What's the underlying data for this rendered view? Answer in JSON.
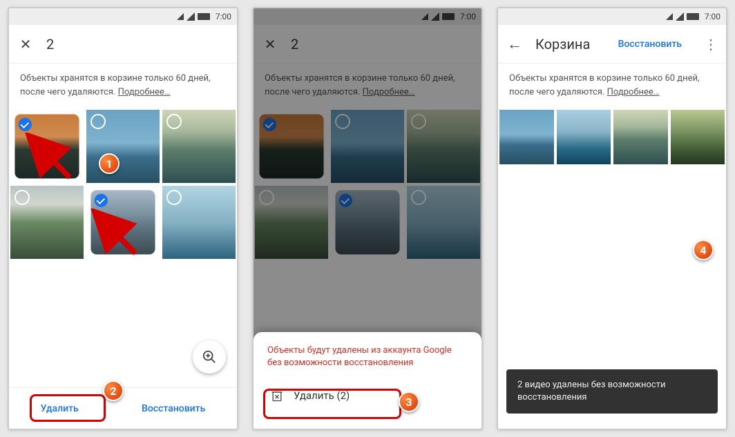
{
  "status": {
    "time": "7:00"
  },
  "screen1": {
    "header_count": "2",
    "info": "Объекты хранятся в корзине только 60 дней, после чего удаляются.",
    "more": "Подробнее…",
    "footer_delete": "Удалить",
    "footer_restore": "Восстановить",
    "thumbs": [
      {
        "cls": "sunset",
        "selected": true
      },
      {
        "cls": "lake1",
        "selected": false
      },
      {
        "cls": "mountain1",
        "selected": false
      },
      {
        "cls": "valley",
        "selected": false
      },
      {
        "cls": "waterfall",
        "selected": true
      },
      {
        "cls": "boat",
        "selected": false
      }
    ]
  },
  "screen2": {
    "header_count": "2",
    "info": "Объекты хранятся в корзине только 60 дней, после чего удаляются.",
    "more": "Подробнее…",
    "warn": "Объекты будут удалены из аккаунта Google без возможности восстановления",
    "sheet_delete": "Удалить (2)",
    "thumbs": [
      {
        "cls": "sunset",
        "selected": true
      },
      {
        "cls": "lake1",
        "selected": false
      },
      {
        "cls": "mountain1",
        "selected": false
      },
      {
        "cls": "valley",
        "selected": false
      },
      {
        "cls": "waterfall",
        "selected": true
      },
      {
        "cls": "boat",
        "selected": false
      }
    ]
  },
  "screen3": {
    "header_title": "Корзина",
    "header_restore": "Восстановить",
    "info": "Объекты хранятся в корзине только 60 дней, после чего удаляются.",
    "more": "Подробнее…",
    "snackbar": "2 видео удалены без возможности восстановления",
    "thumbs": [
      {
        "cls": "lake1"
      },
      {
        "cls": "boats3"
      },
      {
        "cls": "mountain1"
      },
      {
        "cls": "green"
      }
    ]
  },
  "badges": {
    "b1": "1",
    "b2": "2",
    "b3": "3",
    "b4": "4"
  }
}
